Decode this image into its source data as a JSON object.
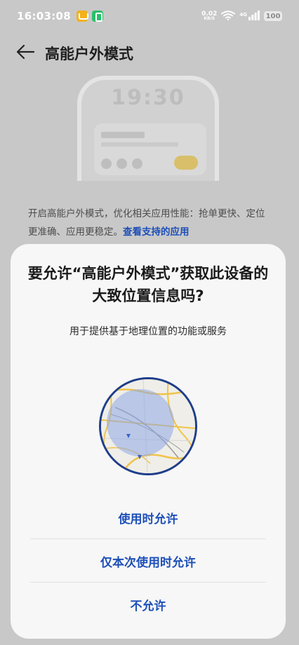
{
  "status_bar": {
    "time": "16:03:08",
    "net_speed_value": "0.02",
    "net_speed_unit": "KB/S",
    "signal_label": "4G",
    "battery": "100"
  },
  "header": {
    "title": "高能户外模式"
  },
  "preview": {
    "clock": "19:30"
  },
  "description": {
    "text": "开启高能户外模式，优化相关应用性能：抢单更快、定位更准确、应用更稳定。",
    "link": "查看支持的应用"
  },
  "dialog": {
    "title": "要允许“高能户外模式”获取此设备的大致位置信息吗?",
    "subtitle": "用于提供基于地理位置的功能或服务",
    "buttons": {
      "while_using": "使用时允许",
      "only_this_time": "仅本次使用时允许",
      "deny": "不允许"
    }
  },
  "colors": {
    "accent": "#1d4fb8",
    "map_border": "#1f3e8a",
    "dialog_bg": "#f7f7f7",
    "scrim": "#c8c8c8"
  },
  "icons": {
    "back": "arrow-left-icon",
    "wifi": "wifi-icon",
    "signal": "signal-bars-icon",
    "battery": "battery-icon",
    "map": "approximate-location-map-icon"
  }
}
